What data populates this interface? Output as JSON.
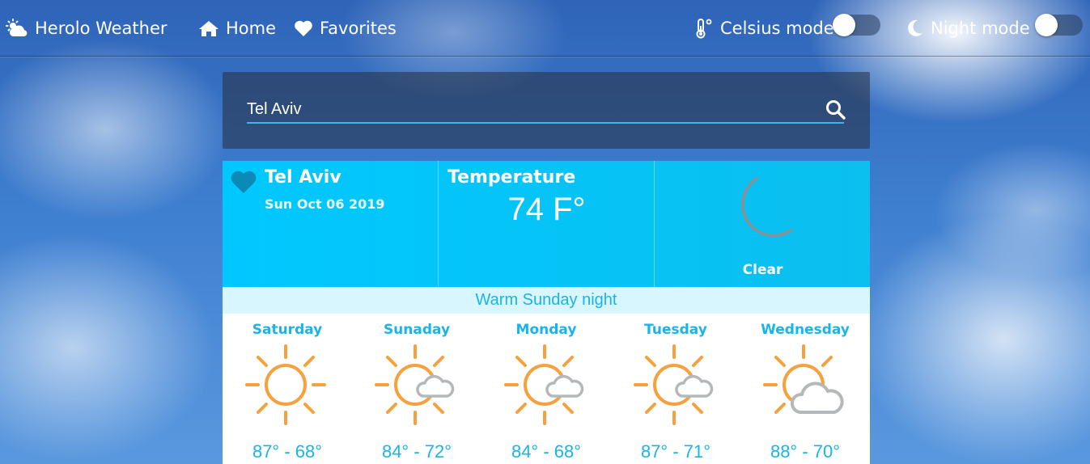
{
  "navbar": {
    "brand": "Herolo Weather",
    "home": "Home",
    "favorites": "Favorites",
    "celsius_mode": "Celsius mode",
    "night_mode": "Night mode",
    "celsius_on": false,
    "night_on": false
  },
  "search": {
    "value": "Tel Aviv"
  },
  "current": {
    "city": "Tel Aviv",
    "date": "Sun Oct 06 2019",
    "temperature_label": "Temperature",
    "temperature": "74 F°",
    "condition": "Clear",
    "icon": "moon-icon"
  },
  "headline": "Warm Sunday night",
  "forecast": [
    {
      "day": "Saturday",
      "range": "87° - 68°",
      "icon": "sun-icon"
    },
    {
      "day": "Sunaday",
      "range": "84° - 72°",
      "icon": "sun-cloud-icon"
    },
    {
      "day": "Monday",
      "range": "84° - 68°",
      "icon": "sun-cloud-icon"
    },
    {
      "day": "Tuesday",
      "range": "87° - 71°",
      "icon": "sun-cloud-icon"
    },
    {
      "day": "Wednesday",
      "range": "88° - 70°",
      "icon": "partly-cloudy-icon"
    }
  ],
  "colors": {
    "accent": "#19b4ea",
    "sun": "#f5a13d",
    "cloud": "#b5b8bb",
    "moon": "#8d8f91"
  }
}
